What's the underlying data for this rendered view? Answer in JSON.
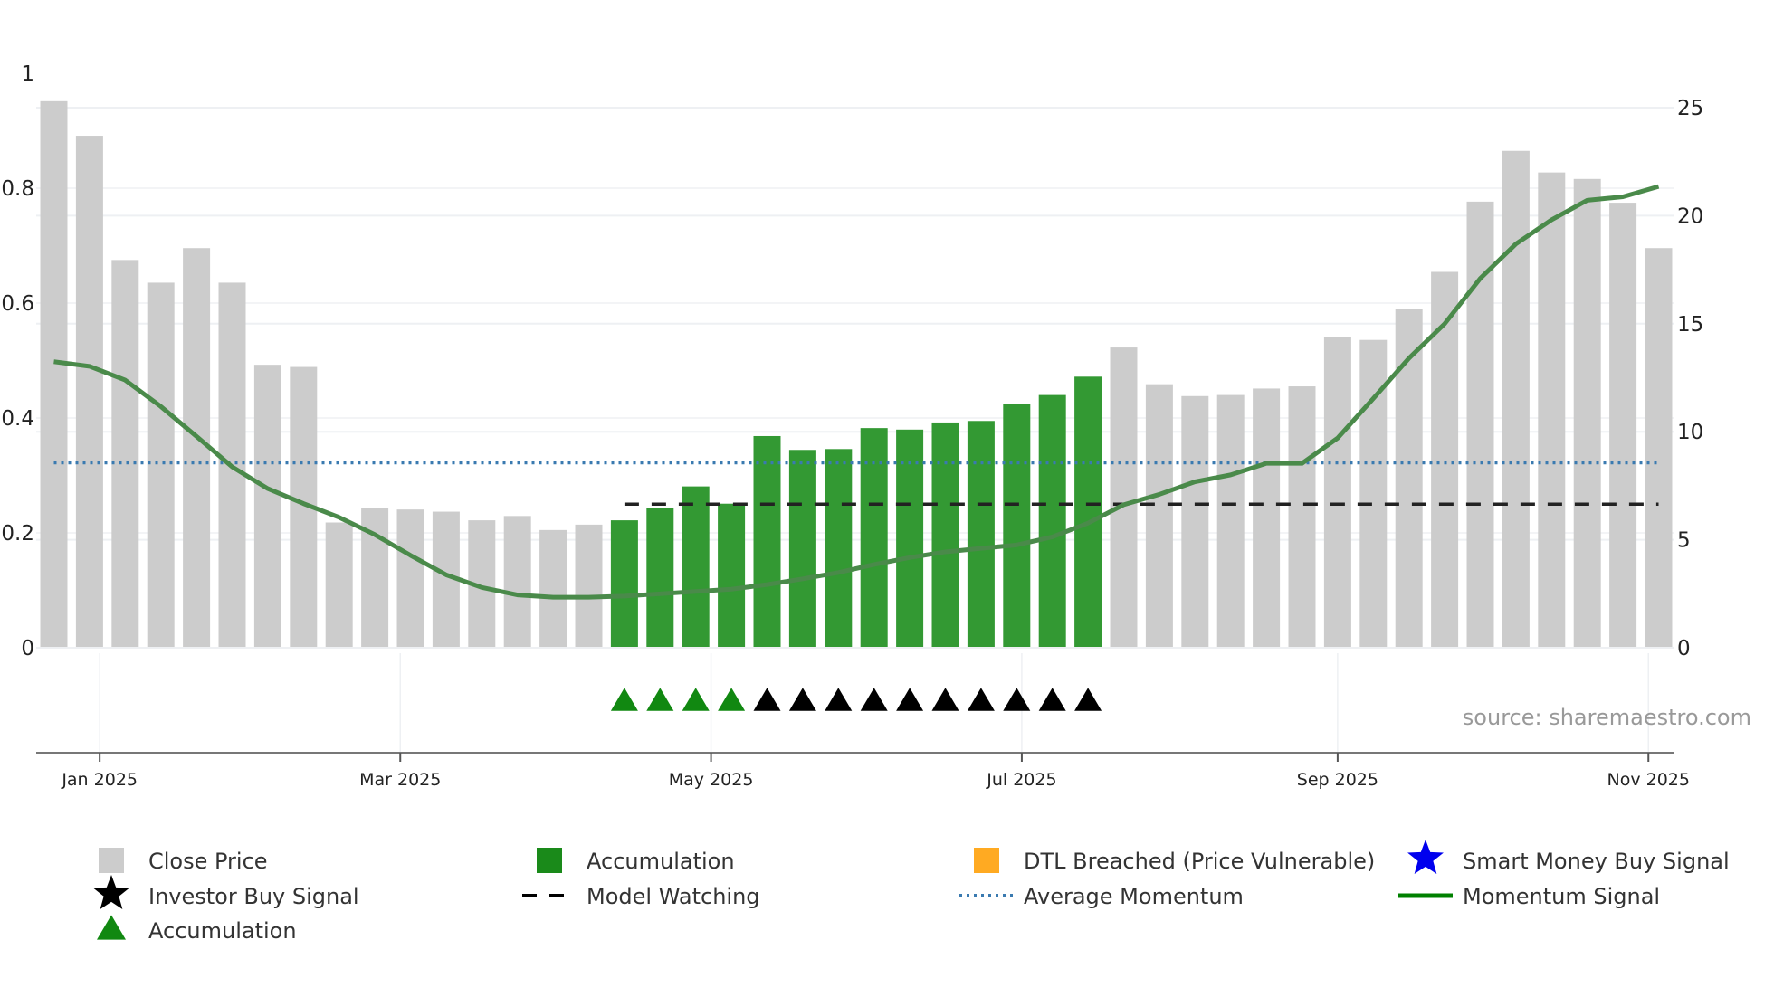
{
  "chart_data": {
    "type": "bar",
    "title": "",
    "start_date": "2024-12-23",
    "interval_days": 7,
    "left_axis": {
      "range": [
        0,
        1
      ],
      "ticks": [
        0,
        0.2,
        0.4,
        0.6,
        0.8,
        1
      ],
      "tick_labels": [
        "0",
        "0.2",
        "0.4",
        "0.6",
        "0.8",
        "1"
      ]
    },
    "right_axis": {
      "range": [
        0,
        25
      ],
      "ticks": [
        0,
        5,
        10,
        15,
        20,
        25
      ],
      "tick_labels": [
        "0",
        "5",
        "10",
        "15",
        "20",
        "25"
      ]
    },
    "x_ticks": [
      {
        "date": "2025-01-01",
        "label": "Jan 2025"
      },
      {
        "date": "2025-03-01",
        "label": "Mar 2025"
      },
      {
        "date": "2025-05-01",
        "label": "May 2025"
      },
      {
        "date": "2025-07-01",
        "label": "Jul 2025"
      },
      {
        "date": "2025-09-01",
        "label": "Sep 2025"
      },
      {
        "date": "2025-11-01",
        "label": "Nov 2025"
      }
    ],
    "close_price": [
      25.3,
      23.7,
      17.95,
      16.9,
      18.5,
      16.9,
      13.1,
      13.0,
      5.8,
      6.46,
      6.4,
      6.3,
      5.9,
      6.1,
      5.45,
      5.7,
      5.9,
      6.46,
      7.47,
      6.67,
      9.8,
      9.16,
      9.2,
      10.17,
      10.1,
      10.43,
      10.5,
      11.3,
      11.7,
      12.55,
      13.9,
      12.2,
      11.65,
      11.7,
      12.0,
      12.1,
      14.4,
      14.25,
      15.7,
      17.4,
      20.65,
      23.0,
      22.0,
      21.7,
      20.6,
      18.5
    ],
    "accumulation_bars": [
      16,
      17,
      18,
      19,
      20,
      21,
      22,
      23,
      24,
      25,
      26,
      27,
      28,
      29
    ],
    "accumulation_markers": [
      16,
      17,
      18,
      19
    ],
    "investor_buy_markers": [
      20,
      21,
      22,
      23,
      24,
      25,
      26,
      27,
      28,
      29
    ],
    "momentum_signal": [
      0.498,
      0.49,
      0.466,
      0.42,
      0.368,
      0.315,
      0.277,
      0.251,
      0.227,
      0.197,
      0.161,
      0.127,
      0.105,
      0.092,
      0.088,
      0.088,
      0.09,
      0.094,
      0.098,
      0.102,
      0.11,
      0.12,
      0.131,
      0.145,
      0.157,
      0.167,
      0.173,
      0.179,
      0.193,
      0.217,
      0.249,
      0.267,
      0.289,
      0.301,
      0.321,
      0.321,
      0.365,
      0.434,
      0.504,
      0.564,
      0.643,
      0.703,
      0.745,
      0.779,
      0.785,
      0.803
    ],
    "average_momentum": 0.322,
    "model_watching": {
      "value": 0.25,
      "from_index": 16
    },
    "grid": true,
    "legend_position": "bottom",
    "colors": {
      "close": "#cccccc",
      "accum": "#339933",
      "accum_marker": "#118811",
      "investor": "#000000",
      "avg": "#3a7ab0",
      "momentum": "#4a8a4a",
      "momentum_strong": "#008000",
      "dtl": "#ffaa22",
      "smart": "#0000ee"
    },
    "legend": [
      {
        "label": "Close Price",
        "icon": "gray-square"
      },
      {
        "label": "Accumulation",
        "icon": "green-square"
      },
      {
        "label": "DTL Breached (Price Vulnerable)",
        "icon": "orange-square"
      },
      {
        "label": "Smart Money Buy Signal",
        "icon": "blue-star"
      },
      {
        "label": "Investor Buy Signal",
        "icon": "black-star"
      },
      {
        "label": "Model Watching",
        "icon": "black-dash"
      },
      {
        "label": "Average Momentum",
        "icon": "blue-dots"
      },
      {
        "label": "Momentum Signal",
        "icon": "green-line"
      },
      {
        "label": "Accumulation",
        "icon": "green-triangle"
      }
    ],
    "source": "source: sharemaestro.com"
  }
}
